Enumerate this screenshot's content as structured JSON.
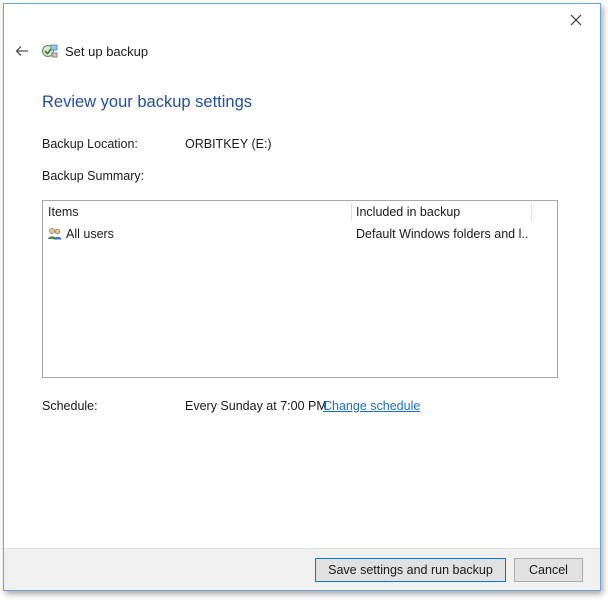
{
  "window": {
    "title": "Set up backup"
  },
  "page": {
    "heading": "Review your backup settings",
    "backup_location_label": "Backup Location:",
    "backup_location_value": "ORBITKEY (E:)",
    "backup_summary_label": "Backup Summary:",
    "summary_table": {
      "columns": [
        "Items",
        "Included in backup"
      ],
      "rows": [
        {
          "item": "All users",
          "included": "Default Windows folders and l...",
          "icon": "users-icon"
        }
      ]
    },
    "schedule_label": "Schedule:",
    "schedule_value": "Every Sunday at 7:00 PM",
    "change_schedule_link": "Change schedule"
  },
  "footer": {
    "primary_button": "Save settings and run backup",
    "cancel_button": "Cancel"
  },
  "icons": {
    "close": "close-icon",
    "back": "back-arrow-icon",
    "app": "backup-icon"
  },
  "colors": {
    "heading": "#1f4fa0",
    "link": "#1a6fc9",
    "window_border": "#6fa4d6",
    "footer_bg": "#f0f0f0"
  }
}
